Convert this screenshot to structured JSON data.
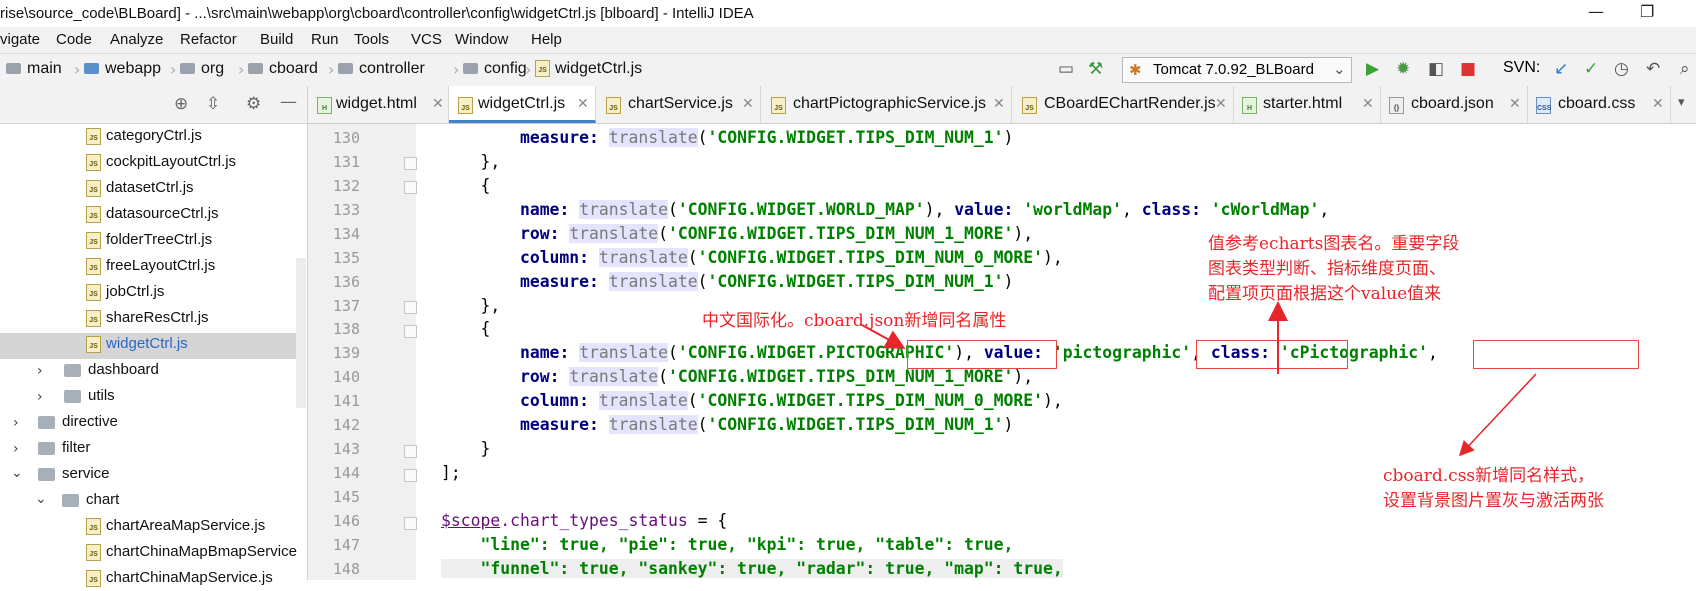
{
  "window": {
    "title": "rise\\source_code\\BLBoard] - ...\\src\\main\\webapp\\org\\cboard\\controller\\config\\widgetCtrl.js [blboard] - IntelliJ IDEA",
    "minimize": "—",
    "restore": "❐"
  },
  "menu": {
    "items": [
      "vigate",
      "Code",
      "Analyze",
      "Refactor",
      "Build",
      "Run",
      "Tools",
      "VCS",
      "Window",
      "Help"
    ]
  },
  "breadcrumb": {
    "items": [
      "main",
      "webapp",
      "org",
      "cboard",
      "controller",
      "config",
      "widgetCtrl.js"
    ]
  },
  "toolbar": {
    "run_config": "Tomcat 7.0.92_BLBoard",
    "svn_label": "SVN:"
  },
  "project_tree": {
    "files": [
      "categoryCtrl.js",
      "cockpitLayoutCtrl.js",
      "datasetCtrl.js",
      "datasourceCtrl.js",
      "folderTreeCtrl.js",
      "freeLayoutCtrl.js",
      "jobCtrl.js",
      "shareResCtrl.js",
      "widgetCtrl.js"
    ],
    "folders": [
      "dashboard",
      "utils",
      "directive",
      "filter",
      "service",
      "chart"
    ],
    "service_files": [
      "chartAreaMapService.js",
      "chartChinaMapBmapService",
      "chartChinaMapService.js"
    ]
  },
  "tabs": [
    {
      "label": "widget.html",
      "type": "html"
    },
    {
      "label": "widgetCtrl.js",
      "type": "js"
    },
    {
      "label": "chartService.js",
      "type": "js"
    },
    {
      "label": "chartPictographicService.js",
      "type": "js"
    },
    {
      "label": "CBoardEChartRender.js",
      "type": "js"
    },
    {
      "label": "starter.html",
      "type": "html"
    },
    {
      "label": "cboard.json",
      "type": "json"
    },
    {
      "label": "cboard.css",
      "type": "css"
    }
  ],
  "line_numbers": [
    "130",
    "131",
    "132",
    "133",
    "134",
    "135",
    "136",
    "137",
    "138",
    "139",
    "140",
    "141",
    "142",
    "143",
    "144",
    "145",
    "146",
    "147",
    "148"
  ],
  "code": {
    "k_measure": "measure",
    "k_name": "name",
    "k_row": "row",
    "k_column": "column",
    "k_value": "value",
    "k_class": "class",
    "fn_translate": "translate",
    "s_tips1": "'CONFIG.WIDGET.TIPS_DIM_NUM_1'",
    "s_world_map": "'CONFIG.WIDGET.WORLD_MAP'",
    "s_worldMap": "'worldMap'",
    "s_cWorldMap": "'cWorldMap'",
    "s_tips1_more": "'CONFIG.WIDGET.TIPS_DIM_NUM_1_MORE'",
    "s_tips0_more": "'CONFIG.WIDGET.TIPS_DIM_NUM_0_MORE'",
    "s_pic_pre": "'CONFIG.WIDGET.",
    "s_pic_key": "PICTOGRAPHIC",
    "s_pic_val": "pictographic",
    "s_pic_cls": "cPictographic",
    "scope": "$scope",
    "chart_types_status": ".chart_types_status",
    "l147": "\"line\": true, \"pie\": true, \"kpi\": true, \"table\": true,",
    "l148": "\"funnel\": true, \"sankey\": true, \"radar\": true, \"map\": true,"
  },
  "annotations": {
    "value_note_1": "值参考echarts图表名。重要字段",
    "value_note_2": "图表类型判断、指标维度页面、",
    "value_note_3": "配置项页面根据这个value值来",
    "i18n_note": "中文国际化。cboard.json新增同名属性",
    "css_note_1": "cboard.css新增同名样式，",
    "css_note_2": "设置背景图片置灰与激活两张"
  },
  "colors": {
    "annotation": "#e8252a",
    "keyword": "#000080",
    "string": "#008000",
    "active_tab_underline": "#4083c9"
  }
}
